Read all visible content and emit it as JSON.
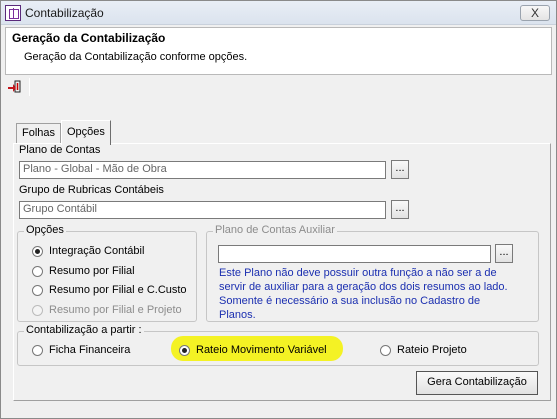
{
  "window": {
    "title": "Contabilização",
    "close_label": "X"
  },
  "header": {
    "title": "Geração da Contabilização",
    "subtitle": "Geração da Contabilização conforme opções."
  },
  "tabs": [
    {
      "label": "Folhas"
    },
    {
      "label": "Opções"
    }
  ],
  "plano_contas": {
    "label": "Plano de Contas",
    "value": "Plano - Global - Mão de Obra",
    "button": "..."
  },
  "grupo_rubricas": {
    "label": "Grupo de Rubricas Contábeis",
    "value": "Grupo Contábil",
    "button": "..."
  },
  "opcoes_group": {
    "title": "Opções",
    "options": [
      {
        "label": "Integração Contábil",
        "checked": true,
        "enabled": true
      },
      {
        "label": "Resumo por Filial",
        "checked": false,
        "enabled": true
      },
      {
        "label": "Resumo por Filial e C.Custo",
        "checked": false,
        "enabled": true
      },
      {
        "label": "Resumo por Filial e Projeto",
        "checked": false,
        "enabled": false
      }
    ]
  },
  "plano_auxiliar": {
    "title": "Plano de Contas Auxiliar",
    "value": "",
    "button": "...",
    "note": "Este Plano não deve possuir outra função a não ser a de servir de auxiliar para a geração dos dois resumos ao lado. Somente é necessário a sua inclusão no Cadastro de Planos."
  },
  "contabilizacao": {
    "title": "Contabilização a partir :",
    "options": [
      {
        "label": "Ficha Financeira",
        "checked": false
      },
      {
        "label": "Rateio Movimento Variável",
        "checked": true
      },
      {
        "label": "Rateio Projeto",
        "checked": false
      }
    ]
  },
  "gera_button": {
    "label": "Gera Contabilização"
  }
}
